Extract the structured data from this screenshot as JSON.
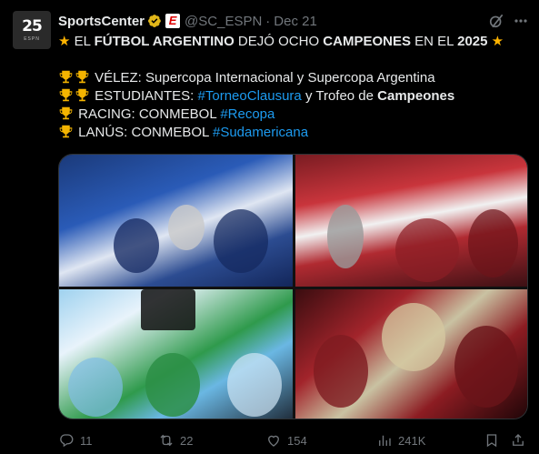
{
  "author": {
    "avatar_text": "25",
    "avatar_sub": "ESPN",
    "name": "SportsCenter",
    "handle": "@SC_ESPN",
    "separator": "·",
    "date": "Dec 21",
    "badge_letter": "E"
  },
  "post": {
    "line1": {
      "star": "★",
      "t1": " EL ",
      "b1": "FÚTBOL ARGENTINO",
      "t2": " DEJÓ OCHO ",
      "b2": "CAMPEONES",
      "t3": " EN EL ",
      "b3": "2025",
      "t4": " "
    },
    "line_velez": {
      "text": " VÉLEZ: Supercopa Internacional y Supercopa Argentina"
    },
    "line_estudiantes": {
      "t1": " ESTUDIANTES: ",
      "hashtag": "#TorneoClausura",
      "t2": " y Trofeo de ",
      "b1": "Campeones"
    },
    "line_racing": {
      "t1": " RACING: CONMEBOL ",
      "hashtag": "#Recopa"
    },
    "line_lanus": {
      "t1": " LANÚS: CONMEBOL ",
      "hashtag": "#Sudamericana"
    }
  },
  "actions": {
    "replies": "11",
    "reposts": "22",
    "likes": "154",
    "views": "241K"
  },
  "colors": {
    "accent": "#1d9bf0",
    "muted": "#71767b",
    "text": "#e7e9ea",
    "background": "#000000",
    "star": "#ffb400",
    "trophy": "#f4b400"
  },
  "icons": [
    "verified-badge-icon",
    "espn-badge-icon",
    "grok-icon",
    "more-icon",
    "trophy-icon",
    "reply-icon",
    "repost-icon",
    "like-icon",
    "views-icon",
    "bookmark-icon",
    "share-icon"
  ]
}
